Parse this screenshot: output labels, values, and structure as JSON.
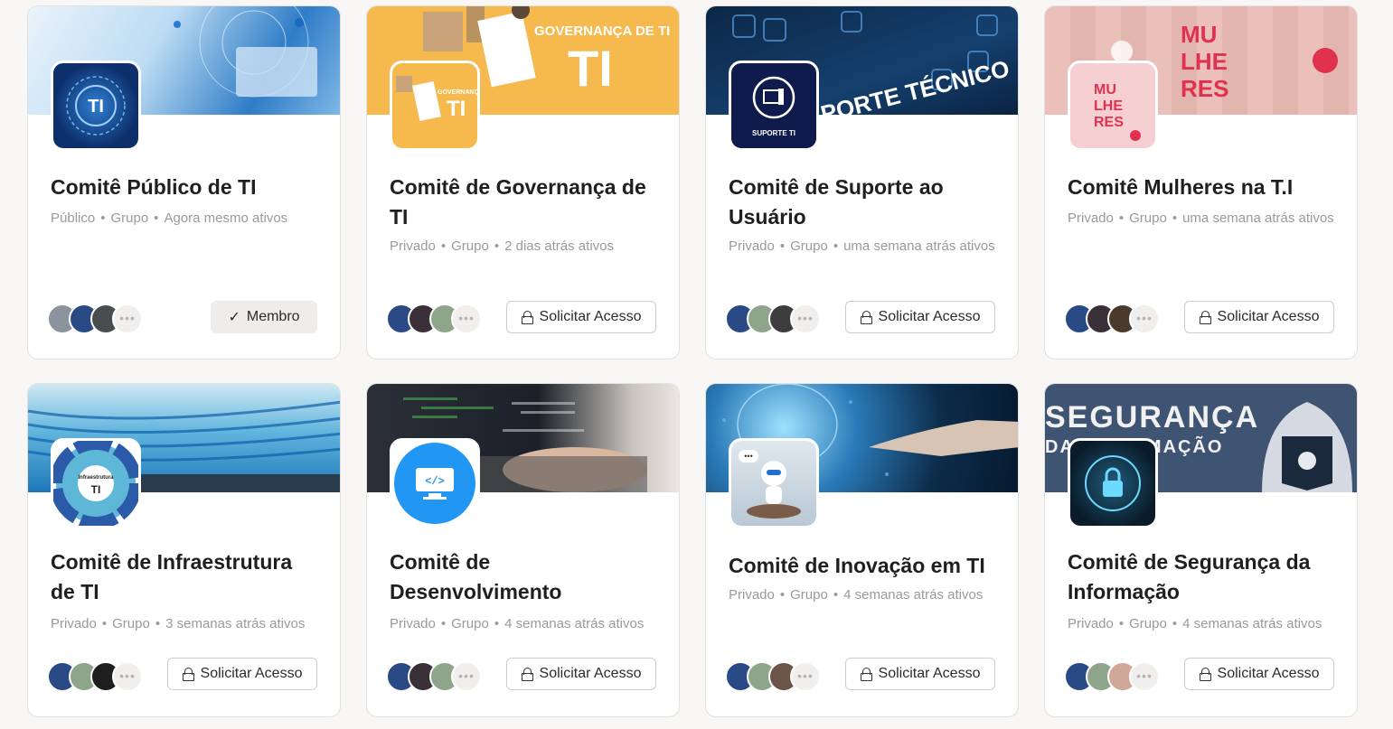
{
  "groups": [
    {
      "title": "Comitê Público de TI",
      "privacy": "Público",
      "type": "Grupo",
      "activity": "Agora mesmo ativos",
      "action": "Membro",
      "icon": "ti-circuit-icon",
      "banner_text": ""
    },
    {
      "title": "Comitê de Governança de TI",
      "privacy": "Privado",
      "type": "Grupo",
      "activity": "2 dias atrás ativos",
      "action": "Solicitar Acesso",
      "icon": "governanca-ti-icon",
      "banner_text": "GOVERNANÇA DE TI",
      "icon_text": "GOVERNANÇA TI"
    },
    {
      "title": "Comitê de Suporte ao Usuário",
      "privacy": "Privado",
      "type": "Grupo",
      "activity": "uma semana atrás ativos",
      "action": "Solicitar Acesso",
      "icon": "suporte-ti-icon",
      "banner_text": "PORTE TÉCNICO",
      "icon_text": "SUPORTE TI"
    },
    {
      "title": "Comitê Mulheres na T.I",
      "privacy": "Privado",
      "type": "Grupo",
      "activity": "uma semana atrás ativos",
      "action": "Solicitar Acesso",
      "icon": "mulheres-tecnologia-icon",
      "banner_text": "MU LHE RES",
      "icon_text": "MU LHE RES"
    },
    {
      "title": "Comitê de Infraestrutura de TI",
      "privacy": "Privado",
      "type": "Grupo",
      "activity": "3 semanas atrás ativos",
      "action": "Solicitar Acesso",
      "icon": "infraestrutura-wheel-icon",
      "banner_text": "",
      "icon_text": "Infraestrutura de TI"
    },
    {
      "title": "Comitê de Desenvolvimento",
      "privacy": "Privado",
      "type": "Grupo",
      "activity": "4 semanas atrás ativos",
      "action": "Solicitar Acesso",
      "icon": "code-monitor-icon",
      "banner_text": ""
    },
    {
      "title": "Comitê de Inovação em TI",
      "privacy": "Privado",
      "type": "Grupo",
      "activity": "4 semanas atrás ativos",
      "action": "Solicitar Acesso",
      "icon": "robot-icon",
      "banner_text": ""
    },
    {
      "title": "Comitê de Segurança da Informação",
      "privacy": "Privado",
      "type": "Grupo",
      "activity": "4 semanas atrás ativos",
      "action": "Solicitar Acesso",
      "icon": "padlock-shield-icon",
      "banner_text": "SEGURANÇA DA INFORMAÇÃO"
    }
  ],
  "more_label": "•••"
}
